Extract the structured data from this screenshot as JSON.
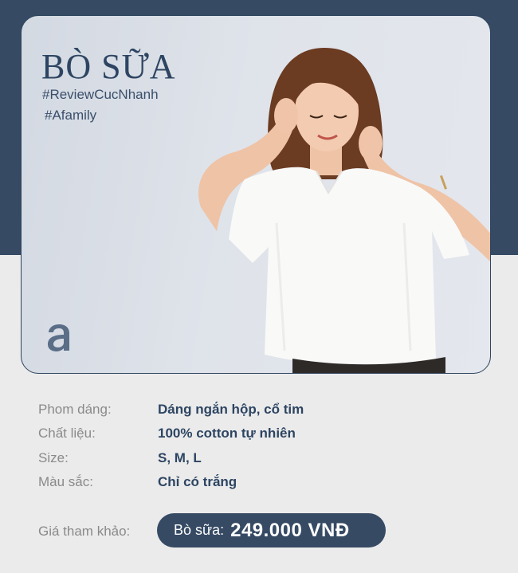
{
  "header": {
    "brand": "BÒ SỮA",
    "hashtags": [
      "#ReviewCucNhanh",
      "#Afamily"
    ],
    "logo_icon": "afamily-logo"
  },
  "colors": {
    "navy": "#364a64",
    "text_navy": "#2d4562",
    "label_gray": "#8a8a8a",
    "background": "#ebebeb"
  },
  "specs": [
    {
      "label": "Phom dáng:",
      "value": "Dáng ngắn hộp, cổ tim"
    },
    {
      "label": "Chất liệu:",
      "value": "100% cotton tự nhiên"
    },
    {
      "label": "Size:",
      "value": "S, M, L"
    },
    {
      "label": "Màu sắc:",
      "value": "Chỉ có trắng"
    }
  ],
  "price": {
    "label": "Giá tham khảo:",
    "prefix": "Bò sữa:",
    "value": "249.000 VNĐ"
  }
}
